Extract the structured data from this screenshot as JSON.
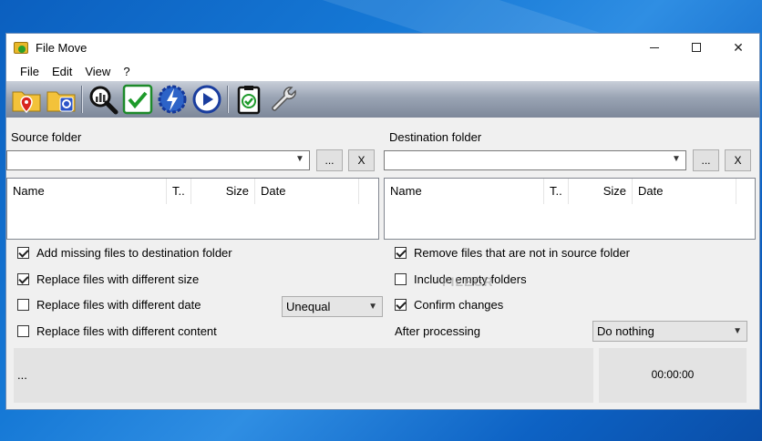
{
  "window": {
    "title": "File Move"
  },
  "menu": [
    "File",
    "Edit",
    "View",
    "?"
  ],
  "toolbar": {
    "icons": [
      "folder-source-pin-icon",
      "folder-dest-icon",
      "analyze-magnifier-icon",
      "check-icon",
      "lightning-gear-icon",
      "play-icon",
      "clipboard-check-icon",
      "wrench-icon"
    ]
  },
  "source": {
    "label": "Source folder",
    "path": "",
    "browse_label": "...",
    "clear_label": "X",
    "columns": [
      "Name",
      "T..",
      "Size",
      "Date"
    ]
  },
  "destination": {
    "label": "Destination folder",
    "path": "",
    "browse_label": "...",
    "clear_label": "X",
    "columns": [
      "Name",
      "T..",
      "Size",
      "Date"
    ]
  },
  "options_left": [
    {
      "label": "Add missing files to destination folder",
      "checked": true
    },
    {
      "label": "Replace files with different size",
      "checked": true
    },
    {
      "label": "Replace files with different date",
      "checked": false
    },
    {
      "label": "Replace files with different content",
      "checked": false
    }
  ],
  "date_compare": {
    "selected": "Unequal"
  },
  "options_right": [
    {
      "label": "Remove files that are not in source folder",
      "checked": true
    },
    {
      "label": "Include empty folders",
      "checked": false
    },
    {
      "label": "Confirm changes",
      "checked": true
    }
  ],
  "after_processing": {
    "label": "After processing",
    "selected": "Do nothing"
  },
  "status": {
    "message": "...",
    "timer": "00:00:00"
  },
  "watermark": "FILECR",
  "colors": {
    "desktop": "#1679d6",
    "toolbar": "#9aa4b4"
  }
}
